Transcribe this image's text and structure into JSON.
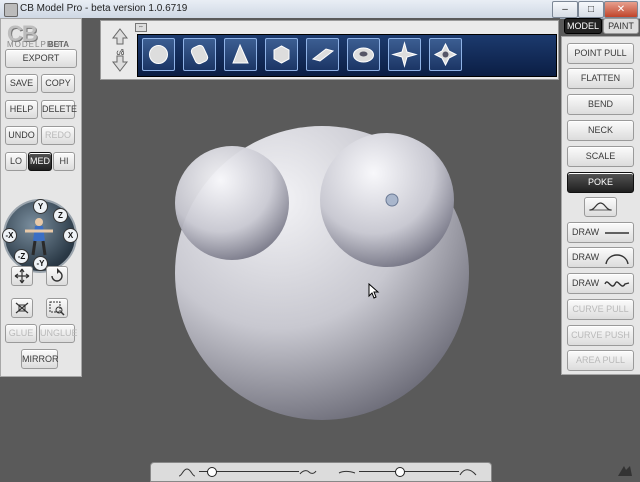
{
  "window": {
    "title": "CB Model Pro - beta version 1.0.6719",
    "minimize": "–",
    "maximize": "□",
    "close": "✕"
  },
  "logo": {
    "cb": "CB",
    "model_pro": "MODELPRO",
    "beta": "BETA"
  },
  "left_panel": {
    "export": "EXPORT",
    "save": "SAVE",
    "copy": "COPY",
    "help": "HELP",
    "delete": "DELETE",
    "undo": "UNDO",
    "redo": "REDO",
    "lo": "LO",
    "med": "MED",
    "hi": "HI",
    "glue": "GLUE",
    "unglue": "UNGLUE",
    "mirror": "MIRROR",
    "gizmo_axes": {
      "y_pos": "Y",
      "y_neg": "-Y",
      "x_pos": "X",
      "x_neg": "-X",
      "z_pos": "Z",
      "z_neg": "-Z"
    }
  },
  "primitives": [
    "sphere",
    "cylinder",
    "cone",
    "cube",
    "plane",
    "torus",
    "star",
    "star-alt"
  ],
  "tabs": {
    "model": "MODEL",
    "paint": "PAINT",
    "active": "model"
  },
  "right_panel": {
    "tools": [
      "POINT PULL",
      "FLATTEN",
      "BEND",
      "NECK",
      "SCALE",
      "POKE"
    ],
    "active_tool": "POKE",
    "draw": [
      "DRAW",
      "DRAW",
      "DRAW"
    ],
    "curve_pull": "CURVE PULL",
    "curve_push": "CURVE PUSH",
    "area_pull": "AREA PULL"
  },
  "sliders": {
    "size": 0.12,
    "strength": 0.4
  },
  "colors": {
    "accent": "#1b3565",
    "panel": "#e6e6e6",
    "viewport": "#5a5a5a"
  }
}
